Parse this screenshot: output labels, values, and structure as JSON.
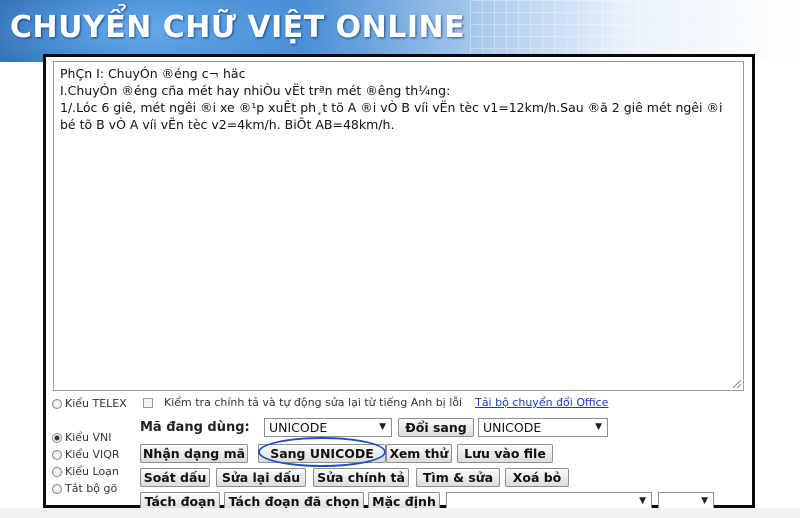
{
  "banner": {
    "title": "CHUYỂN CHỮ VIỆT ONLINE"
  },
  "editor": {
    "lines": [
      "PhÇn I: ChuyÓn ®éng c¬ häc",
      "I.ChuyÓn ®éng cña mét hay nhiÒu vËt trªn mét ®êng th¼ng:",
      "1/.Lóc 6 giê, mét ng­êi ®i xe ®¹p xuÊt ph¸t tõ A ®i vÒ B víi vËn tèc v1=12km/h.Sau ®ã 2 giê mét ng­êi ®i bé tõ B vÒ A víi vËn tèc v2=4km/h. BiÕt AB=48km/h."
    ]
  },
  "controls": {
    "radio_telex": "Kiểu TELEX",
    "radio_vni": "Kiểu VNI",
    "radio_viqr": "Kiểu VIQR",
    "radio_loan": "Kiểu Loạn",
    "radio_off": "Tắt bộ gõ",
    "spellcheck_label": "Kiểm tra chính tả và tự động sửa lại từ tiếng Anh bị lỗi",
    "office_link": "Tải bộ chuyển đổi Office",
    "encoding_label": "Mã đang dùng:",
    "encoding_value": "UNICODE",
    "convert_button": "Đổi sang",
    "target_value": "UNICODE",
    "buttons_row1": [
      "Nhận dạng mã",
      "Sang UNICODE",
      "Xem thử",
      "Lưu vào file"
    ],
    "buttons_row2": [
      "Soát dấu",
      "Sửa lại dấu",
      "Sửa chính tả",
      "Tìm & sửa",
      "Xoá bỏ"
    ],
    "buttons_row3": [
      "Tách đoạn",
      "Tách đoạn đã chọn",
      "Mặc định"
    ],
    "bottom_select_value": "",
    "bottom_select2_value": ""
  },
  "colors": {
    "accent_ellipse": "#1f4fc7",
    "banner_blue": "#2f6fb7",
    "link": "#1a3fb0"
  }
}
